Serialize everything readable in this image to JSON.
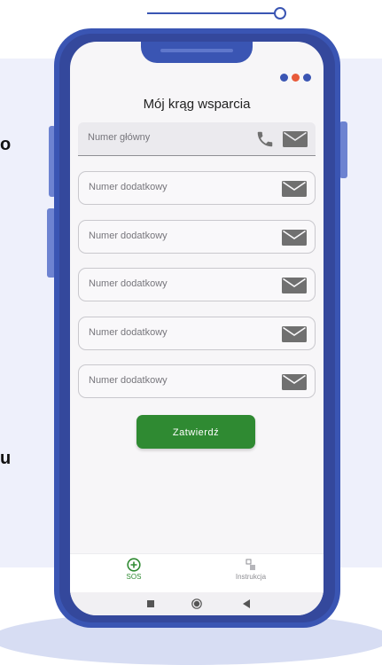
{
  "background": {
    "edge_chars": [
      "o",
      "u"
    ]
  },
  "screen": {
    "title": "Mój krąg wsparcia",
    "status_dot_colors": [
      "#3a55b3",
      "#e85a3a",
      "#3a55b3"
    ],
    "fields": [
      {
        "placeholder": "Numer główny",
        "icons": [
          "phone-icon",
          "mail-icon"
        ]
      },
      {
        "placeholder": "Numer dodatkowy",
        "icons": [
          "mail-icon"
        ]
      },
      {
        "placeholder": "Numer dodatkowy",
        "icons": [
          "mail-icon"
        ]
      },
      {
        "placeholder": "Numer dodatkowy",
        "icons": [
          "mail-icon"
        ]
      },
      {
        "placeholder": "Numer dodatkowy",
        "icons": [
          "mail-icon"
        ]
      },
      {
        "placeholder": "Numer dodatkowy",
        "icons": [
          "mail-icon"
        ]
      }
    ],
    "submit_label": "Zatwierdź"
  },
  "bottom_nav": {
    "items": [
      {
        "label": "SOS",
        "icon": "sos-plus-icon",
        "active": true
      },
      {
        "label": "Instrukcja",
        "icon": "instruction-icon",
        "active": false
      }
    ]
  },
  "system_nav": {
    "buttons": [
      "recent-apps-icon",
      "home-icon",
      "back-icon"
    ]
  },
  "colors": {
    "accent_green": "#2f8a32",
    "phone_frame": "#3a55b3",
    "icon_gray": "#707070",
    "nav_inactive": "#8e8e93"
  }
}
